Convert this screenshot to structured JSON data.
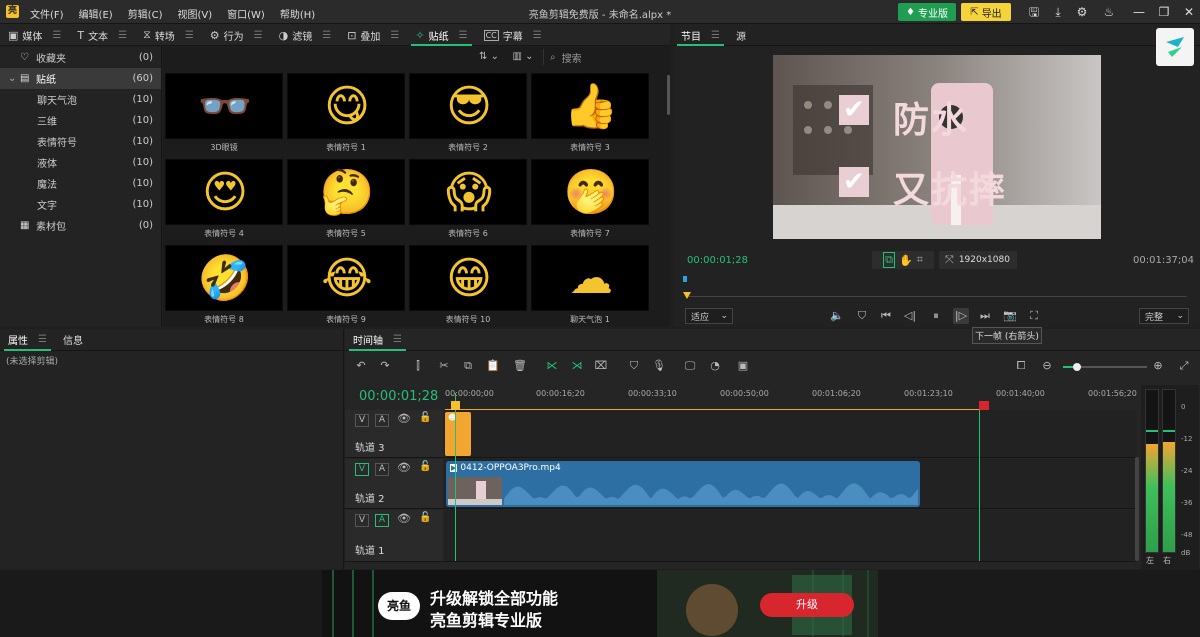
{
  "menubar": {
    "logo": "亮",
    "items": [
      "文件(F)",
      "编辑(E)",
      "剪辑(C)",
      "视图(V)",
      "窗口(W)",
      "帮助(H)"
    ],
    "title": "亮鱼剪辑免费版 - 未命名.alpx *",
    "pro_label": "专业版",
    "export_label": "导出"
  },
  "tabs": [
    {
      "icon": "▣",
      "label": "媒体"
    },
    {
      "icon": "T",
      "label": "文本"
    },
    {
      "icon": "⧖",
      "label": "转场"
    },
    {
      "icon": "⚙",
      "label": "行为"
    },
    {
      "icon": "◑",
      "label": "滤镜"
    },
    {
      "icon": "⊡",
      "label": "叠加"
    },
    {
      "icon": "✧",
      "label": "贴纸"
    },
    {
      "icon": "CC",
      "label": "字幕"
    }
  ],
  "leftnav": [
    {
      "label": "收藏夹",
      "count": "(0)",
      "level": 0
    },
    {
      "label": "贴纸",
      "count": "(60)",
      "level": 0,
      "selected": true
    },
    {
      "label": "聊天气泡",
      "count": "(10)",
      "level": 1
    },
    {
      "label": "三维",
      "count": "(10)",
      "level": 1
    },
    {
      "label": "表情符号",
      "count": "(10)",
      "level": 1
    },
    {
      "label": "液体",
      "count": "(10)",
      "level": 1
    },
    {
      "label": "魔法",
      "count": "(10)",
      "level": 1
    },
    {
      "label": "文字",
      "count": "(10)",
      "level": 1
    },
    {
      "label": "素材包",
      "count": "(0)",
      "level": 0
    }
  ],
  "search_placeholder": "搜索",
  "stickers": [
    {
      "label": "3D眼镜",
      "emoji": "👓"
    },
    {
      "label": "表情符号 1",
      "emoji": "😋"
    },
    {
      "label": "表情符号 2",
      "emoji": "😎"
    },
    {
      "label": "表情符号 3",
      "emoji": "👍"
    },
    {
      "label": "表情符号 4",
      "emoji": "😍"
    },
    {
      "label": "表情符号 5",
      "emoji": "🤔"
    },
    {
      "label": "表情符号 6",
      "emoji": "😱"
    },
    {
      "label": "表情符号 7",
      "emoji": "🤭"
    },
    {
      "label": "表情符号 8",
      "emoji": "🤣"
    },
    {
      "label": "表情符号 9",
      "emoji": "😂"
    },
    {
      "label": "表情符号 10",
      "emoji": "😁"
    },
    {
      "label": "聊天气泡 1",
      "emoji": "☁"
    }
  ],
  "monitor": {
    "tab_program": "节目",
    "tab_source": "源",
    "line1": "防水",
    "line2": "又抗摔",
    "current_time": "00:00:01;28",
    "duration": "00:01:37;04",
    "resolution": "1920x1080",
    "fit_label": "适应",
    "quality_label": "完整",
    "tooltip": "下一帧 (右箭头)"
  },
  "props": {
    "tab_props": "属性",
    "tab_info": "信息",
    "empty": "(未选择剪辑)"
  },
  "timeline": {
    "tab": "时间轴",
    "current_time": "00:00:01;28",
    "ticks": [
      "00:00:00;00",
      "00:00:16;20",
      "00:00:33;10",
      "00:00:50;00",
      "00:01:06;20",
      "00:01:23;10",
      "00:01:40;00",
      "00:01:56;20"
    ],
    "tracks": [
      {
        "name": "轨道 3",
        "v": "V",
        "a": "A"
      },
      {
        "name": "轨道 2",
        "v": "V",
        "a": "A"
      },
      {
        "name": "轨道 1",
        "v": "V",
        "a": "A"
      }
    ],
    "clip_name": "0412-OPPOA3Pro.mp4",
    "meter_labels": [
      "0",
      "-12",
      "-24",
      "-36",
      "-48",
      "dB"
    ],
    "meter_lr": [
      "左",
      "右"
    ]
  },
  "banner": {
    "logo": "亮鱼",
    "line1": "升级解锁全部功能",
    "line2": "亮鱼剪辑专业版",
    "button": "升级"
  },
  "colors": {
    "accent": "#24c07a",
    "pro": "#1f9e52",
    "export": "#f5d33b",
    "upgrade": "#d8262f",
    "clip": "#2e6fa3",
    "sticker_clip": "#f2a531"
  }
}
